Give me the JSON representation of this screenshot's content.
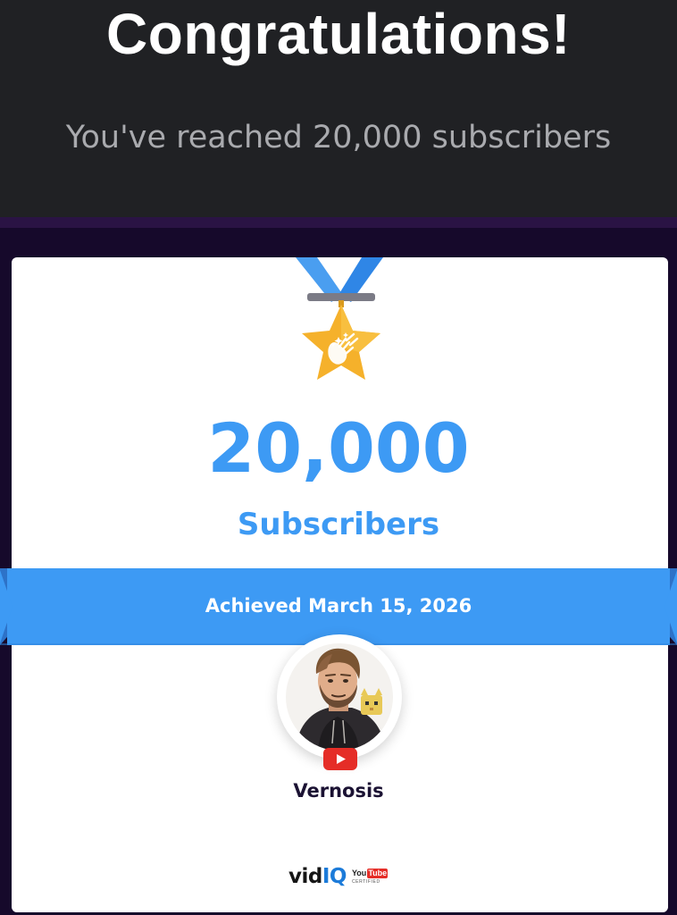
{
  "header": {
    "title": "Congratulations!",
    "subtitle": "You've reached 20,000 subscribers"
  },
  "milestone": {
    "count": "20,000",
    "unit": "Subscribers",
    "achieved_text": "Achieved March 15, 2026"
  },
  "channel": {
    "name": "Vernosis",
    "platform_icon": "youtube-play-icon"
  },
  "branding": {
    "vid": "vid",
    "iq": "IQ",
    "yt_you": "You",
    "yt_tube": "Tube",
    "yt_certified": "CERTIFIED"
  },
  "colors": {
    "header_bg": "#202124",
    "page_bg": "#16092b",
    "accent_blue": "#3d9af4",
    "medal_gold": "#f5b12b",
    "youtube_red": "#e52d27",
    "channel_name": "#1b1233"
  },
  "icons": {
    "medal": "star-medal-icon",
    "clapping_hands": "clapping-hands-icon"
  }
}
